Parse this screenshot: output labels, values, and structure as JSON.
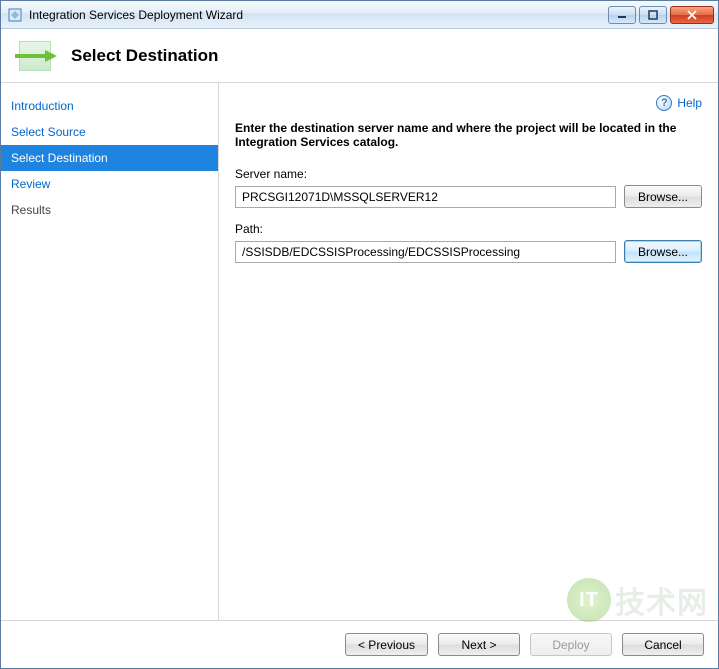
{
  "window": {
    "title": "Integration Services Deployment Wizard"
  },
  "header": {
    "heading": "Select Destination"
  },
  "sidebar": {
    "items": [
      {
        "label": "Introduction"
      },
      {
        "label": "Select Source"
      },
      {
        "label": "Select Destination"
      },
      {
        "label": "Review"
      },
      {
        "label": "Results"
      }
    ]
  },
  "help": {
    "label": "Help"
  },
  "main": {
    "instruction": "Enter the destination server name and where the project will be located in the Integration Services catalog.",
    "server_label": "Server name:",
    "server_value": "PRCSGI12071D\\MSSQLSERVER12",
    "server_browse": "Browse...",
    "path_label": "Path:",
    "path_value": "/SSISDB/EDCSSISProcessing/EDCSSISProcessing",
    "path_browse": "Browse..."
  },
  "footer": {
    "previous": "< Previous",
    "next": "Next >",
    "deploy": "Deploy",
    "cancel": "Cancel"
  },
  "watermark": {
    "badge": "IT",
    "text": "技术网"
  }
}
